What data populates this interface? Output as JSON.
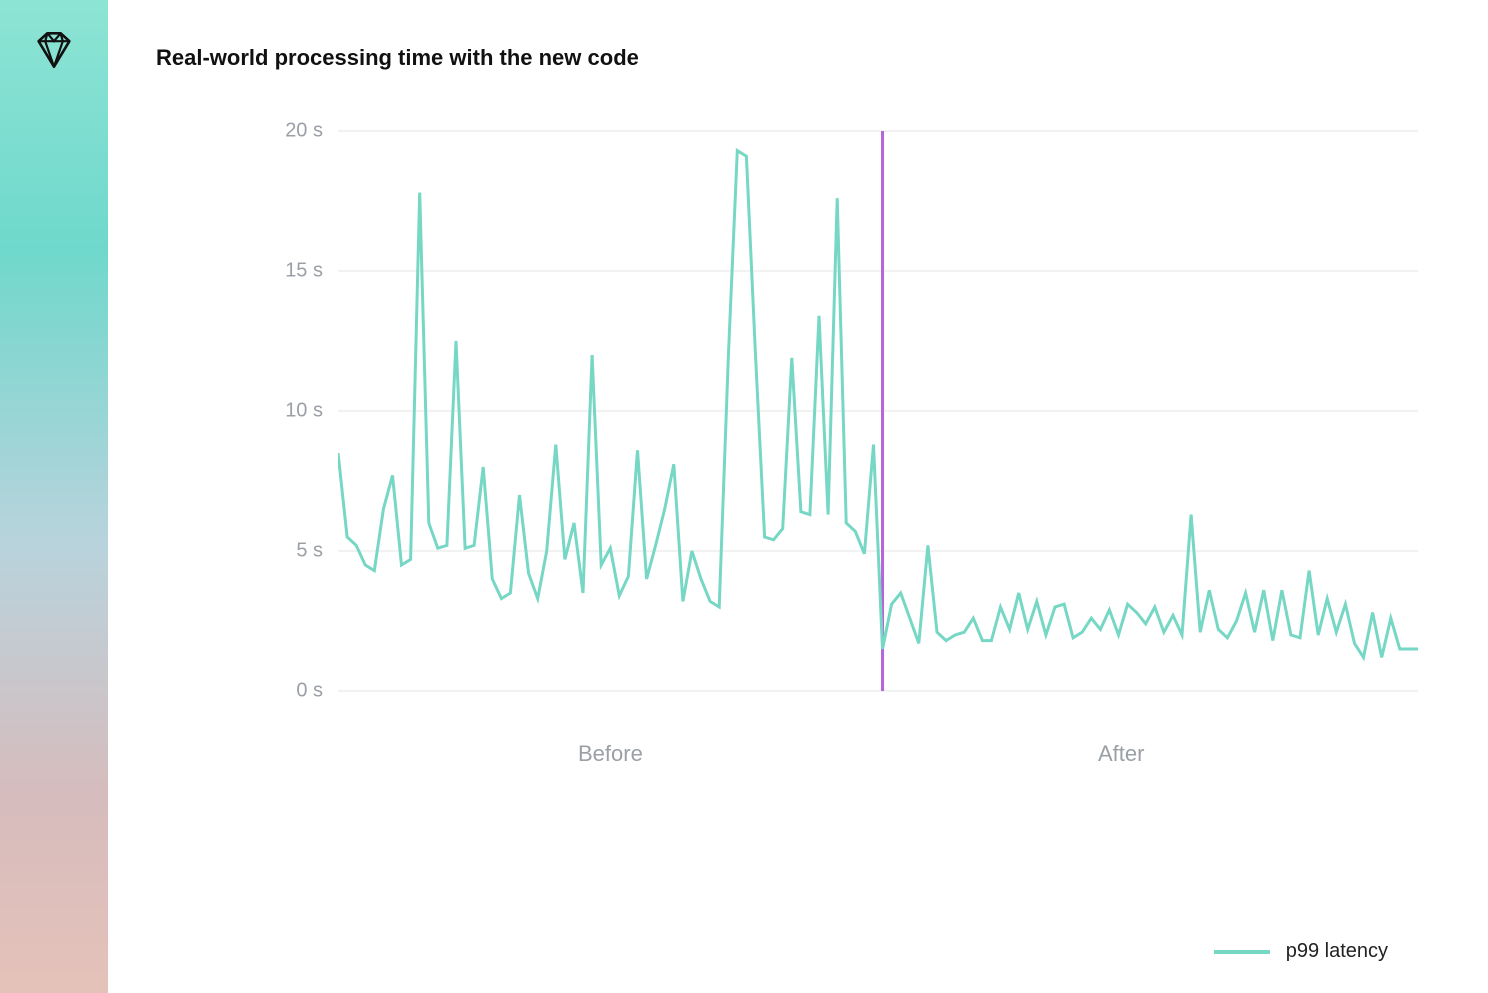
{
  "title": "Real-world processing time with the new code",
  "legend": {
    "label": "p99 latency"
  },
  "colors": {
    "series": "#76d7c4",
    "divider": "#b565d8",
    "grid": "#e6e6e6",
    "axis_text": "#9aa0a6"
  },
  "chart_data": {
    "type": "line",
    "ylabel": "",
    "xlabel": "",
    "ylim": [
      0,
      20
    ],
    "y_ticks": [
      "0 s",
      "5 s",
      "10 s",
      "15 s",
      "20 s"
    ],
    "x_sections": [
      "Before",
      "After"
    ],
    "divider_index": 60,
    "series": [
      {
        "name": "p99 latency",
        "values": [
          8.5,
          5.5,
          5.2,
          4.5,
          4.3,
          6.5,
          7.7,
          4.5,
          4.7,
          17.8,
          6.0,
          5.1,
          5.2,
          12.5,
          5.1,
          5.2,
          8.0,
          4.0,
          3.3,
          3.5,
          7.0,
          4.2,
          3.3,
          5.0,
          8.8,
          4.7,
          6.0,
          3.5,
          12.0,
          4.5,
          5.1,
          3.4,
          4.1,
          8.6,
          4.0,
          5.2,
          6.5,
          8.1,
          3.2,
          5.0,
          4.0,
          3.2,
          3.0,
          11.9,
          19.3,
          19.1,
          12.0,
          5.5,
          5.4,
          5.8,
          11.9,
          6.4,
          6.3,
          13.4,
          6.3,
          17.6,
          6.0,
          5.7,
          4.9,
          8.8,
          1.5,
          3.1,
          3.5,
          2.6,
          1.7,
          5.2,
          2.1,
          1.8,
          2.0,
          2.1,
          2.6,
          1.8,
          1.8,
          3.0,
          2.2,
          3.5,
          2.2,
          3.2,
          2.0,
          3.0,
          3.1,
          1.9,
          2.1,
          2.6,
          2.2,
          2.9,
          2.0,
          3.1,
          2.8,
          2.4,
          3.0,
          2.1,
          2.7,
          2.0,
          6.3,
          2.1,
          3.6,
          2.2,
          1.9,
          2.5,
          3.5,
          2.1,
          3.6,
          1.8,
          3.6,
          2.0,
          1.9,
          4.3,
          2.0,
          3.3,
          2.1,
          3.1,
          1.7,
          1.2,
          2.8,
          1.2,
          2.6,
          1.5,
          1.5,
          1.5
        ]
      }
    ]
  }
}
